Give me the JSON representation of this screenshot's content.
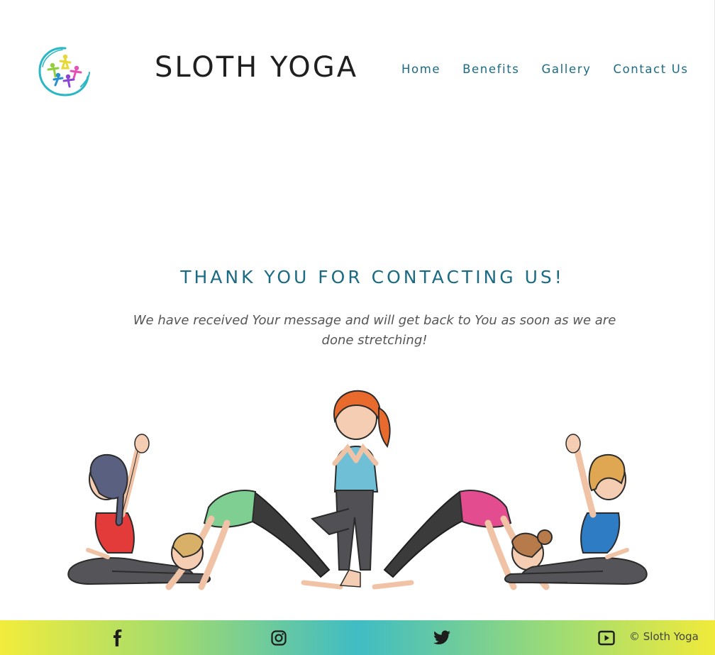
{
  "header": {
    "brand": "SLOTH YOGA",
    "nav": [
      "Home",
      "Benefits",
      "Gallery",
      "Contact Us"
    ]
  },
  "main": {
    "title": "THANK YOU FOR CONTACTING US!",
    "message": "We have received Your message and will get back to You as soon as we are done stretching!"
  },
  "footer": {
    "social_icons": [
      "facebook-icon",
      "instagram-icon",
      "twitter-icon",
      "youtube-icon"
    ],
    "copyright": "© Sloth Yoga"
  },
  "colors": {
    "accent": "#1c6b84",
    "brand_text": "#1f1f1f",
    "footer_gradient": [
      "#f2ec3c",
      "#3fbcc4",
      "#f1ea3a"
    ]
  }
}
